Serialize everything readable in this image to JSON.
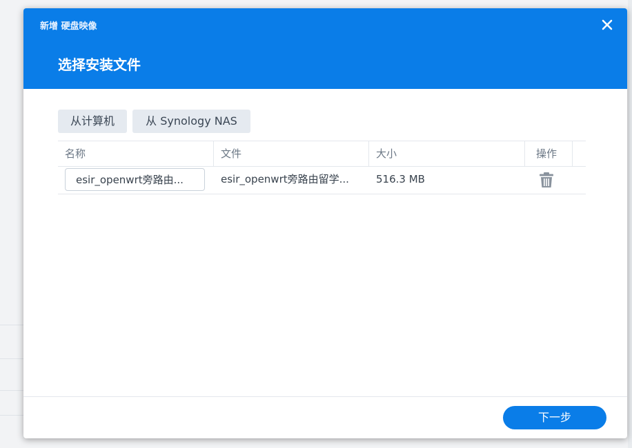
{
  "dialog": {
    "window_title": "新增 硬盘映像",
    "step_title": "选择安装文件"
  },
  "source_buttons": {
    "from_computer": "从计算机",
    "from_nas": "从 Synology NAS"
  },
  "table": {
    "columns": [
      "名称",
      "文件",
      "大小",
      "操作"
    ],
    "rows": [
      {
        "name": "esir_openwrt旁路由...",
        "file": "esir_openwrt旁路由留学...",
        "size": "516.3 MB"
      }
    ]
  },
  "footer": {
    "next_label": "下一步"
  },
  "colors": {
    "accent": "#0a7de8",
    "button_secondary": "#e5eaf0",
    "icon_gray": "#8a939e"
  },
  "icons": {
    "close": "close-icon",
    "delete": "trash-icon"
  }
}
